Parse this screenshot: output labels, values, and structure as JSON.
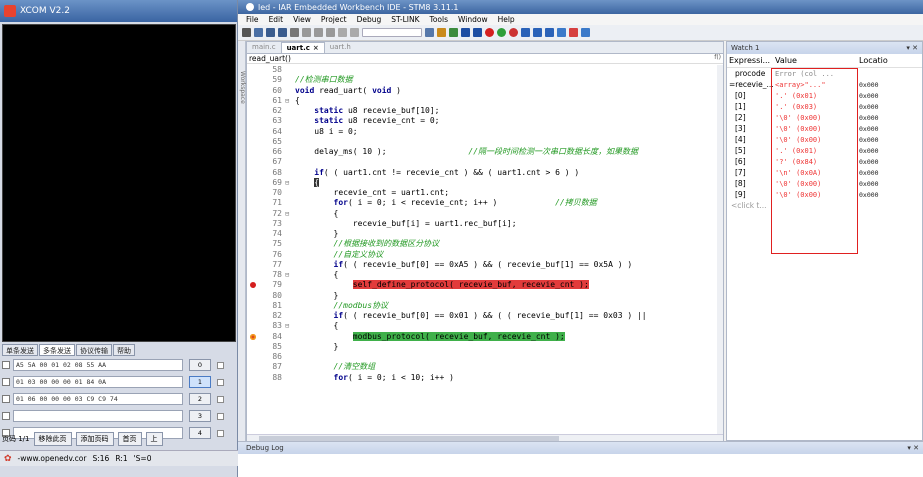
{
  "xcom": {
    "title": "XCOM V2.2",
    "tabs": [
      "单条发送",
      "多条发送",
      "协议传输",
      "帮助"
    ],
    "rows": [
      {
        "value": "A5 5A 00 01 02 08 55 AA",
        "num": "0",
        "selected": false
      },
      {
        "value": "01 03 00 00 00 01 84 0A",
        "num": "1",
        "selected": true
      },
      {
        "value": "01 06 00 00 00 03 C9 C9 74",
        "num": "2",
        "selected": false
      },
      {
        "value": "",
        "num": "3",
        "selected": false
      },
      {
        "value": "",
        "num": "4",
        "selected": false
      }
    ],
    "bottom": {
      "page": "页码 1/1",
      "remove": "移除此页",
      "add": "添加页码",
      "first": "首页",
      "prev": "上"
    },
    "status": {
      "url": "-www.openedv.cor",
      "s": "S:16",
      "r": "R:1",
      "extra": "'S=0"
    }
  },
  "iar": {
    "title": "led - IAR Embedded Workbench IDE - STM8 3.11.1",
    "menu": [
      "File",
      "Edit",
      "View",
      "Project",
      "Debug",
      "ST-LINK",
      "Tools",
      "Window",
      "Help"
    ],
    "workspace_label": "Workspace",
    "editor": {
      "tabs": [
        {
          "label": "main.c",
          "active": false
        },
        {
          "label": "uart.c",
          "active": true
        },
        {
          "label": "uart.h",
          "active": false
        }
      ],
      "function": "read_uart()",
      "fu_label": "f()"
    },
    "watch": {
      "title": "Watch 1",
      "headers": [
        "Expressi...",
        "Value",
        "Locatio"
      ],
      "rows": [
        {
          "expr": "procode",
          "value": "Error (col ...",
          "loc": "",
          "grey": true
        },
        {
          "expr": "=recevie_...",
          "value": "<array>\"...\"",
          "loc": "0x000",
          "grey": false
        },
        {
          "expr": "[0]",
          "value": "'.' (0x01)",
          "loc": "0x000",
          "grey": false
        },
        {
          "expr": "[1]",
          "value": "'.' (0x03)",
          "loc": "0x000",
          "grey": false
        },
        {
          "expr": "[2]",
          "value": "'\\0' (0x00)",
          "loc": "0x000",
          "grey": false
        },
        {
          "expr": "[3]",
          "value": "'\\0' (0x00)",
          "loc": "0x000",
          "grey": false
        },
        {
          "expr": "[4]",
          "value": "'\\0' (0x00)",
          "loc": "0x000",
          "grey": false
        },
        {
          "expr": "[5]",
          "value": "'.' (0x01)",
          "loc": "0x000",
          "grey": false
        },
        {
          "expr": "[6]",
          "value": "'?' (0x84)",
          "loc": "0x000",
          "grey": false
        },
        {
          "expr": "[7]",
          "value": "'\\n' (0x0A)",
          "loc": "0x000",
          "grey": false
        },
        {
          "expr": "[8]",
          "value": "'\\0' (0x00)",
          "loc": "0x000",
          "grey": false
        },
        {
          "expr": "[9]",
          "value": "'\\0' (0x00)",
          "loc": "0x000",
          "grey": false
        }
      ],
      "click_row": "<click t..."
    },
    "debug_log_title": "Debug Log"
  }
}
